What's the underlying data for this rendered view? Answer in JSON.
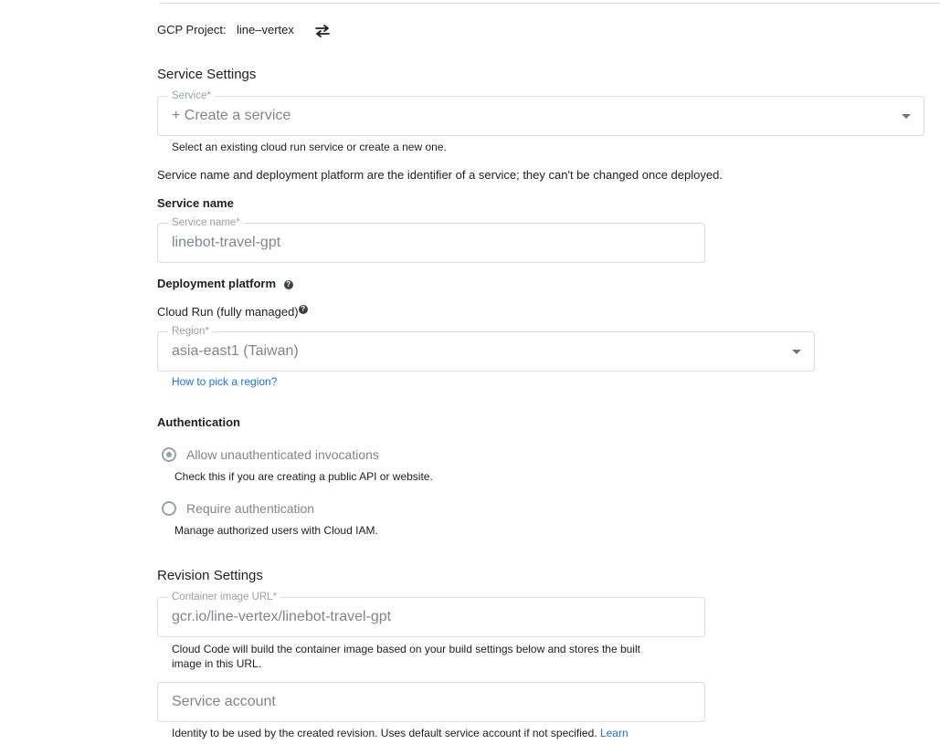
{
  "project": {
    "label": "GCP Project:",
    "name": "line–vertex",
    "switch_icon": "swap-icon"
  },
  "service_settings": {
    "title": "Service Settings",
    "service_field": {
      "label": "Service*",
      "value": "+ Create a service",
      "hint": "Select an existing cloud run service or create a new one."
    },
    "note": "Service name and deployment platform are the identifier of a service; they can't be changed once deployed.",
    "service_name": {
      "heading": "Service name",
      "label": "Service name*",
      "value": "linebot-travel-gpt"
    },
    "deployment": {
      "heading": "Deployment platform",
      "platform": "Cloud Run (fully managed)",
      "region_label": "Region*",
      "region_value": "asia-east1 (Taiwan)",
      "region_help_link": "How to pick a region?"
    },
    "authentication": {
      "heading": "Authentication",
      "options": [
        {
          "label": "Allow unauthenticated invocations",
          "hint": "Check this if you are creating a public API or website.",
          "selected": true
        },
        {
          "label": "Require authentication",
          "hint": "Manage authorized users with Cloud IAM.",
          "selected": false
        }
      ]
    }
  },
  "revision_settings": {
    "title": "Revision Settings",
    "container_image": {
      "label": "Container image URL*",
      "value": "gcr.io/line-vertex/linebot-travel-gpt",
      "hint_line1": "Cloud Code will build the container image based on your build settings below and stores the built",
      "hint_line2": "image in this URL."
    },
    "service_account": {
      "placeholder": "Service account",
      "hint": "Identity to be used by the created revision. Uses default service account if not specified.",
      "learn_link": "Learn"
    }
  }
}
